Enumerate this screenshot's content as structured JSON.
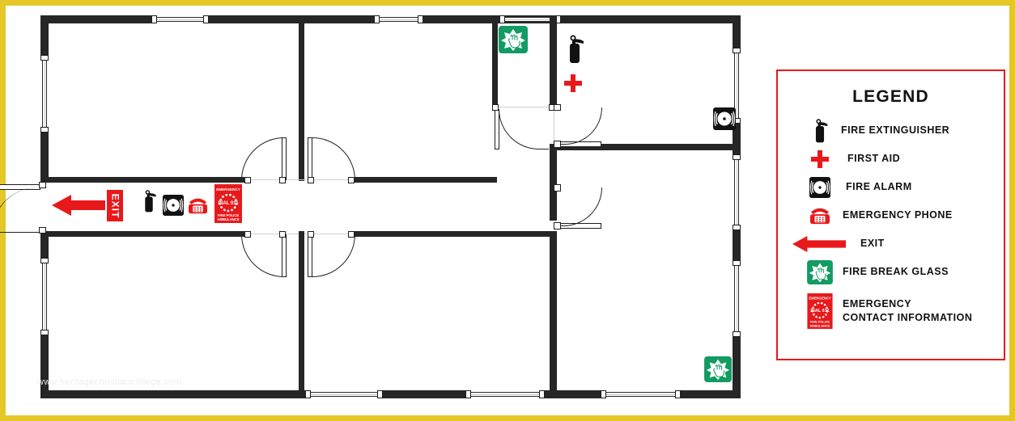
{
  "page": {
    "frame_color": "#e5c727",
    "background": "#ffffff",
    "watermark": "www.heritagechristiancollege.com"
  },
  "plan": {
    "name": "fire-evacuation-floor-plan",
    "wall_color": "#262626",
    "markers": [
      {
        "id": "fire-break-glass-top",
        "type": "fire-break-glass",
        "label": "FIRE BREAK GLASS"
      },
      {
        "id": "fire-extinguisher-top-right",
        "type": "fire-extinguisher",
        "label": "FIRE EXTINGUISHER"
      },
      {
        "id": "first-aid-top-right",
        "type": "first-aid",
        "label": "FIRST AID"
      },
      {
        "id": "fire-alarm-right",
        "type": "fire-alarm",
        "label": "FIRE ALARM"
      },
      {
        "id": "exit-corridor-left",
        "type": "exit",
        "label": "EXIT"
      },
      {
        "id": "fire-extinguisher-corridor",
        "type": "fire-extinguisher",
        "label": "FIRE EXTINGUISHER"
      },
      {
        "id": "fire-alarm-corridor",
        "type": "fire-alarm",
        "label": "FIRE ALARM"
      },
      {
        "id": "emergency-phone-corridor",
        "type": "emergency-phone",
        "label": "EMERGENCY PHONE"
      },
      {
        "id": "emergency-contact-corridor",
        "type": "emergency-contact",
        "label": "EMERGENCY CONTACT INFORMATION"
      },
      {
        "id": "fire-break-glass-bottom-right",
        "type": "fire-break-glass",
        "label": "FIRE BREAK GLASS"
      }
    ],
    "exit_sign_text": "EXIT"
  },
  "legend": {
    "title": "LEGEND",
    "border_color": "#e8191b",
    "items": [
      {
        "icon": "fire-extinguisher-icon",
        "label": "FIRE EXTINGUISHER"
      },
      {
        "icon": "first-aid-icon",
        "label": "FIRST AID"
      },
      {
        "icon": "fire-alarm-icon",
        "label": "FIRE ALARM"
      },
      {
        "icon": "emergency-phone-icon",
        "label": "EMERGENCY PHONE"
      },
      {
        "icon": "exit-arrow-icon",
        "label": "EXIT"
      },
      {
        "icon": "fire-break-glass-icon",
        "label": "FIRE BREAK GLASS"
      },
      {
        "icon": "emergency-contact-icon",
        "label_line1": "EMERGENCY",
        "label_line2": "CONTACT INFORMATION"
      }
    ]
  },
  "icon_colors": {
    "red": "#e8191b",
    "green": "#129b63",
    "black": "#111111",
    "white": "#ffffff"
  },
  "emergency_card": {
    "heading": "EMERGENCY",
    "dial": "DIAL 911",
    "services": "FIRE POLICE AMBULANCE"
  }
}
